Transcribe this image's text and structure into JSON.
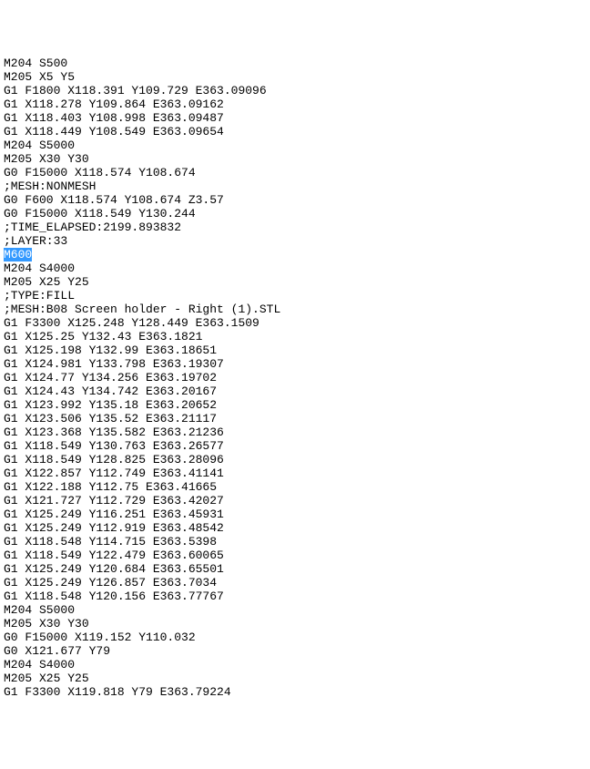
{
  "lines": [
    "M204 S500",
    "M205 X5 Y5",
    "G1 F1800 X118.391 Y109.729 E363.09096",
    "G1 X118.278 Y109.864 E363.09162",
    "G1 X118.403 Y108.998 E363.09487",
    "G1 X118.449 Y108.549 E363.09654",
    "M204 S5000",
    "M205 X30 Y30",
    "G0 F15000 X118.574 Y108.674",
    ";MESH:NONMESH",
    "G0 F600 X118.574 Y108.674 Z3.57",
    "G0 F15000 X118.549 Y130.244",
    ";TIME_ELAPSED:2199.893832",
    ";LAYER:33",
    "M600",
    "M204 S4000",
    "M205 X25 Y25",
    ";TYPE:FILL",
    ";MESH:B08 Screen holder - Right (1).STL",
    "G1 F3300 X125.248 Y128.449 E363.1509",
    "G1 X125.25 Y132.43 E363.1821",
    "G1 X125.198 Y132.99 E363.18651",
    "G1 X124.981 Y133.798 E363.19307",
    "G1 X124.77 Y134.256 E363.19702",
    "G1 X124.43 Y134.742 E363.20167",
    "G1 X123.992 Y135.18 E363.20652",
    "G1 X123.506 Y135.52 E363.21117",
    "G1 X123.368 Y135.582 E363.21236",
    "G1 X118.549 Y130.763 E363.26577",
    "G1 X118.549 Y128.825 E363.28096",
    "G1 X122.857 Y112.749 E363.41141",
    "G1 X122.188 Y112.75 E363.41665",
    "G1 X121.727 Y112.729 E363.42027",
    "G1 X125.249 Y116.251 E363.45931",
    "G1 X125.249 Y112.919 E363.48542",
    "G1 X118.548 Y114.715 E363.5398",
    "G1 X118.549 Y122.479 E363.60065",
    "G1 X125.249 Y120.684 E363.65501",
    "G1 X125.249 Y126.857 E363.7034",
    "G1 X118.548 Y120.156 E363.77767",
    "M204 S5000",
    "M205 X30 Y30",
    "G0 F15000 X119.152 Y110.032",
    "G0 X121.677 Y79",
    "M204 S4000",
    "M205 X25 Y25",
    "G1 F3300 X119.818 Y79 E363.79224"
  ],
  "highlighted_line_index": 14
}
